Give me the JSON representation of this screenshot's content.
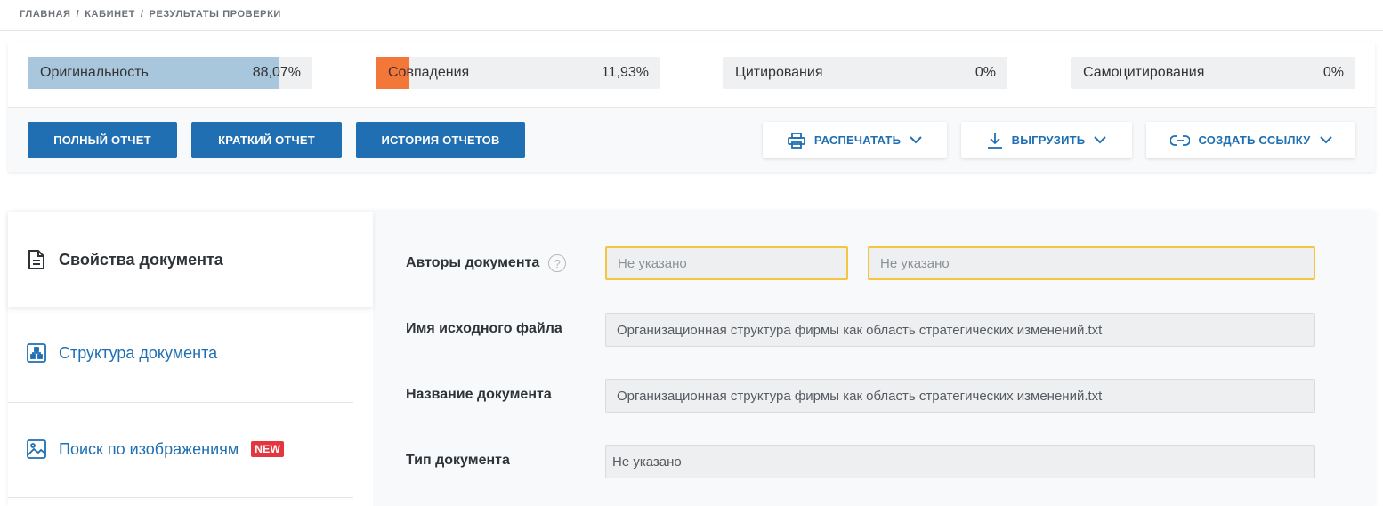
{
  "breadcrumb": {
    "items": [
      "ГЛАВНАЯ",
      "КАБИНЕТ",
      "РЕЗУЛЬТАТЫ ПРОВЕРКИ"
    ],
    "separator": "/"
  },
  "stats": [
    {
      "label": "Оригинальность",
      "value": "88,07%",
      "fraction": 0.8807,
      "color": "#a8c6dc"
    },
    {
      "label": "Совпадения",
      "value": "11,93%",
      "fraction": 0.1193,
      "color": "#f27738"
    },
    {
      "label": "Цитирования",
      "value": "0%",
      "fraction": 0,
      "color": "#6fb36f"
    },
    {
      "label": "Самоцитирования",
      "value": "0%",
      "fraction": 0,
      "color": "#f2c94c"
    }
  ],
  "actions": {
    "full_report": "ПОЛНЫЙ ОТЧЕТ",
    "short_report": "КРАТКИЙ ОТЧЕТ",
    "report_history": "ИСТОРИЯ ОТЧЕТОВ",
    "print": "РАСПЕЧАТАТЬ",
    "download": "ВЫГРУЗИТЬ",
    "create_link": "СОЗДАТЬ ССЫЛКУ"
  },
  "sidebar": {
    "items": [
      {
        "label": "Свойства документа",
        "icon": "document-icon",
        "active": true
      },
      {
        "label": "Структура документа",
        "icon": "structure-icon",
        "active": false
      },
      {
        "label": "Поиск по изображениям",
        "icon": "image-icon",
        "active": false,
        "badge": "NEW"
      }
    ]
  },
  "form": {
    "authors": {
      "label": "Авторы документа",
      "help": "?",
      "placeholder_1": "Не указано",
      "placeholder_2": "Не указано"
    },
    "source_file": {
      "label": "Имя исходного файла",
      "value": "Организационная структура фирмы как область стратегических изменений.txt"
    },
    "doc_name": {
      "label": "Название документа",
      "value": "Организационная структура фирмы как область стратегических изменений.txt"
    },
    "doc_type": {
      "label": "Тип документа",
      "value": "Не указано"
    }
  },
  "colors": {
    "primary": "#1f6fb2",
    "warning_border": "#f5c542",
    "new_badge": "#e3363f"
  }
}
